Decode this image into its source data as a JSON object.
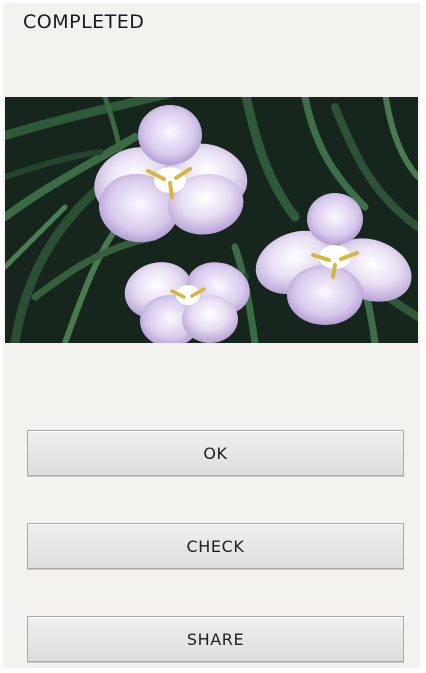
{
  "header": {
    "title": "COMPLETED"
  },
  "photo": {
    "subject": "purple and white iris flowers with green leaves"
  },
  "buttons": {
    "ok": "OK",
    "check": "CHECK",
    "share": "SHARE"
  }
}
